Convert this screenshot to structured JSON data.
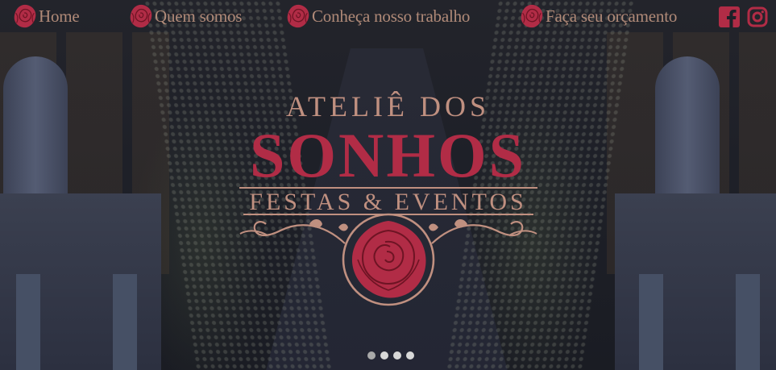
{
  "nav": {
    "items": [
      {
        "label": "Home"
      },
      {
        "label": "Quem somos"
      },
      {
        "label": "Conheça nosso trabalho"
      },
      {
        "label": "Faça seu orçamento"
      }
    ],
    "social": [
      {
        "icon": "facebook-icon"
      },
      {
        "icon": "instagram-icon"
      }
    ]
  },
  "logo": {
    "line1": "ATELIÊ DOS",
    "line2": "SONHOS",
    "line3": "FESTAS & EVENTOS"
  },
  "carousel": {
    "slides": 4,
    "active": 1
  },
  "colors": {
    "accent": "#b12c46",
    "gold": "#c09080",
    "background": "#1c1d24"
  }
}
